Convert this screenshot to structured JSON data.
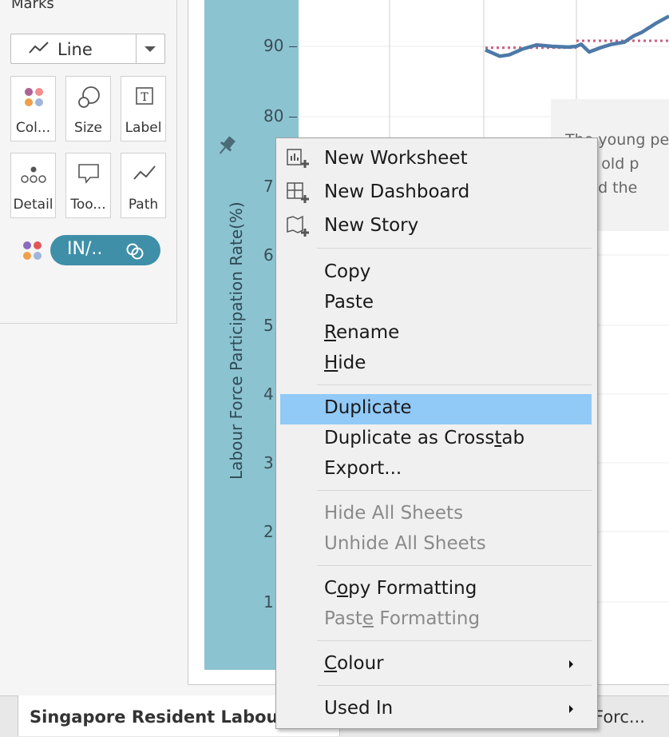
{
  "marks": {
    "title": "Marks",
    "mark_type": "Line",
    "buttons": [
      {
        "label": "Col..."
      },
      {
        "label": "Size"
      },
      {
        "label": "Label"
      },
      {
        "label": "Detail"
      },
      {
        "label": "Too..."
      },
      {
        "label": "Path"
      }
    ],
    "pill_label": "IN/.."
  },
  "chart": {
    "y_axis_title": "Labour Force Participation Rate(%)",
    "ticks": [
      "90",
      "80",
      "7",
      "6",
      "5",
      "4",
      "3",
      "2",
      "1"
    ],
    "annotation_lines": [
      "The young pe",
      "e as old p",
      "upied the"
    ]
  },
  "chart_data": {
    "type": "line",
    "title": "",
    "xlabel": "",
    "ylabel": "Labour Force Participation Rate(%)",
    "ylim": [
      0,
      100
    ],
    "series": [
      {
        "values": [
          89.5,
          88.6,
          88.8,
          89.6,
          90.2,
          90.0,
          89.9,
          90.0,
          90.3,
          89.2,
          89.8,
          90.3,
          90.6,
          91.5,
          92.0,
          93.3,
          94.3
        ]
      }
    ],
    "reference_values": [
      89.8,
      90.8
    ]
  },
  "context_menu": {
    "items": [
      {
        "label": "New Worksheet"
      },
      {
        "label": "New Dashboard"
      },
      {
        "label": "New Story"
      },
      {
        "label": "Copy"
      },
      {
        "label": "Paste"
      },
      {
        "label_pre": "",
        "label_u": "R",
        "label_post": "ename"
      },
      {
        "label_pre": "",
        "label_u": "H",
        "label_post": "ide"
      },
      {
        "label": "Duplicate"
      },
      {
        "label_pre": "Duplicate as Cross",
        "label_u": "t",
        "label_post": "ab"
      },
      {
        "label": "Export..."
      },
      {
        "label": "Hide All Sheets"
      },
      {
        "label": "Unhide All Sheets"
      },
      {
        "label_pre": "C",
        "label_u": "o",
        "label_post": "py Formatting"
      },
      {
        "label_pre": "Past",
        "label_u": "e",
        "label_post": " Formatting"
      },
      {
        "label_pre": "",
        "label_u": "C",
        "label_post": "olour"
      },
      {
        "label": "Used In"
      }
    ]
  },
  "tabs": {
    "active": "Singapore Resident Labour",
    "other": "Forc..."
  },
  "colors": {
    "axis_band": "#8cc3d1",
    "line": "#4e79a7",
    "reference": "#c9607e",
    "highlight": "#91c9f7",
    "pill": "#3f8fa8"
  }
}
